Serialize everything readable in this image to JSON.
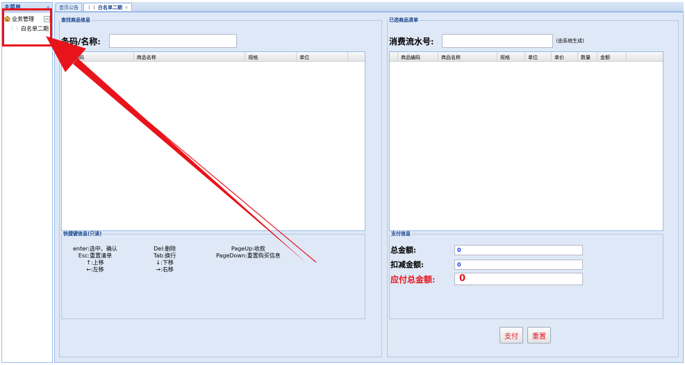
{
  "menu": {
    "title": "主菜单",
    "collapse": "«",
    "root": "业务管理",
    "root_toggle": "−",
    "child_dots": "⋮⋮",
    "child": "白名单二期"
  },
  "tabs": [
    {
      "label": "首页公告"
    },
    {
      "label": "白名单二期",
      "dots": "⋮⋮",
      "close": "×"
    }
  ],
  "search_panel": {
    "legend": "查找商品信息",
    "field_label": "条码/名称:",
    "columns": [
      "商品编码",
      "商品名称",
      "规格",
      "单位"
    ]
  },
  "shortcut_panel": {
    "legend": "快捷键信息(只读)",
    "col1": [
      "enter:选中、确认",
      "Esc:重置清单",
      "↑:上移",
      "←:左移"
    ],
    "col2": [
      "Del:删除",
      "Tab:换行",
      "↓:下移",
      "→:右移"
    ],
    "col3": [
      "PageUp:收款",
      "PageDown:重置购买信息"
    ]
  },
  "selected_panel": {
    "legend": "已选商品清单",
    "serial_label": "消费流水号:",
    "serial_hint": "(由系统生成)",
    "columns": [
      "商品编码",
      "商品名称",
      "规格",
      "单位",
      "单价",
      "数量",
      "金额"
    ]
  },
  "payment_panel": {
    "legend": "支付信息",
    "total_label": "总金额:",
    "total_value": "0",
    "discount_label": "扣减金额:",
    "discount_value": "0",
    "payable_label": "应付总金额:",
    "payable_value": "0"
  },
  "buttons": {
    "pay": "支付",
    "reset": "重置"
  },
  "colors": {
    "highlight": "#e8141c",
    "panel_bg": "#dfe8f6",
    "header_text": "#15428b"
  }
}
